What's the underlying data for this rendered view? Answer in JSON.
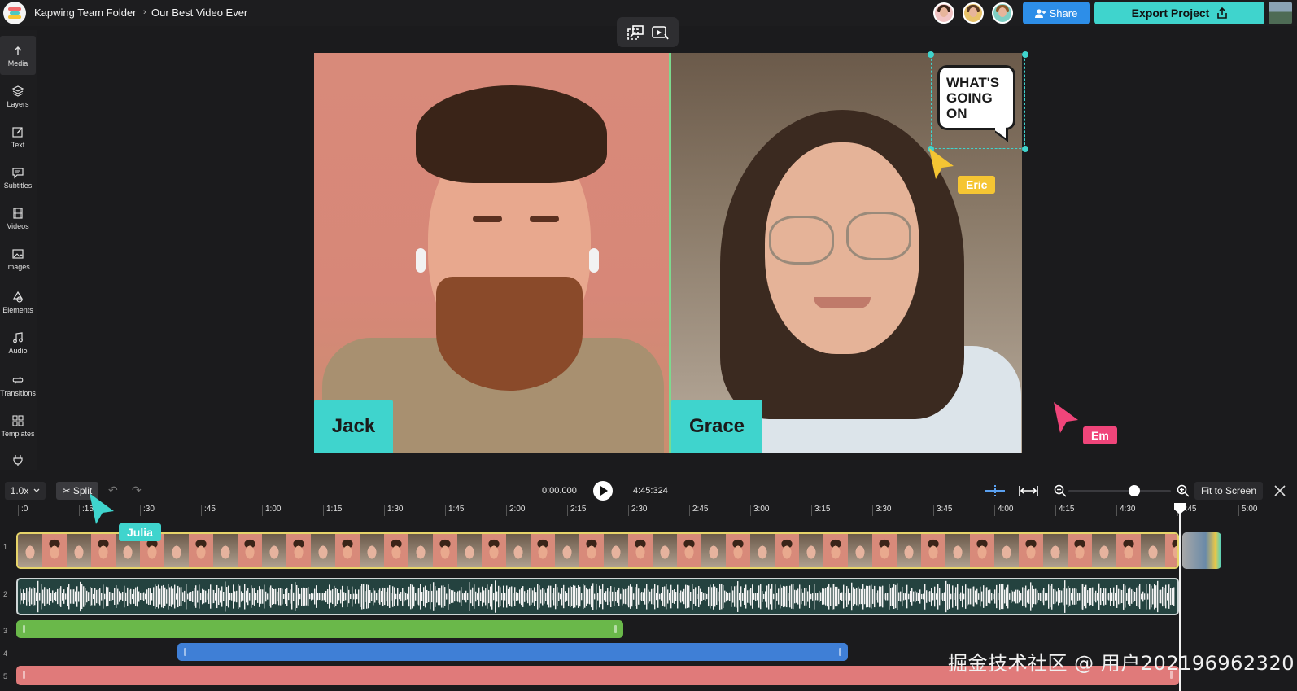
{
  "header": {
    "folder": "Kapwing Team Folder",
    "separator": "›",
    "project_title": "Our Best Video Ever",
    "share_label": "Share",
    "export_label": "Export Project",
    "brand_colors": {
      "share": "#2d8ee8",
      "export": "#3fd4cd"
    }
  },
  "sidebar": {
    "items": [
      {
        "label": "Media",
        "icon": "upload-icon"
      },
      {
        "label": "Layers",
        "icon": "layers-icon"
      },
      {
        "label": "Text",
        "icon": "text-edit-icon"
      },
      {
        "label": "Subtitles",
        "icon": "subtitles-icon"
      },
      {
        "label": "Videos",
        "icon": "film-icon"
      },
      {
        "label": "Images",
        "icon": "image-icon"
      },
      {
        "label": "Elements",
        "icon": "shapes-icon"
      },
      {
        "label": "Audio",
        "icon": "music-note-icon"
      },
      {
        "label": "Transitions",
        "icon": "transitions-icon"
      },
      {
        "label": "Templates",
        "icon": "grid-icon"
      }
    ]
  },
  "canvas": {
    "left_name": "Jack",
    "right_name": "Grace",
    "speech_bubble": [
      "WHAT'S",
      "GOING",
      "ON"
    ],
    "cursors": [
      {
        "name": "Eric",
        "color": "#f5c533"
      },
      {
        "name": "Em",
        "color": "#f0457a"
      },
      {
        "name": "Julia",
        "color": "#3fd4cd"
      }
    ]
  },
  "timeline": {
    "speed": "1.0x",
    "split_label": "Split",
    "current_time": "0:00.000",
    "total_time": "4:45:324",
    "fit_label": "Fit to Screen",
    "ruler_ticks": [
      ":0",
      ":15",
      ":30",
      ":45",
      "1:00",
      "1:15",
      "1:30",
      "1:45",
      "2:00",
      "2:15",
      "2:30",
      "2:45",
      "3:00",
      "3:15",
      "3:30",
      "3:45",
      "4:00",
      "4:15",
      "4:30",
      "4:45",
      "5:00"
    ],
    "track_numbers": [
      "1",
      "2",
      "3",
      "4",
      "5"
    ],
    "track_colors": {
      "green": "#6ab84a",
      "blue": "#3f7fd6",
      "red": "#e07a7a"
    }
  },
  "watermark": "掘金技术社区 @ 用户202196962320"
}
